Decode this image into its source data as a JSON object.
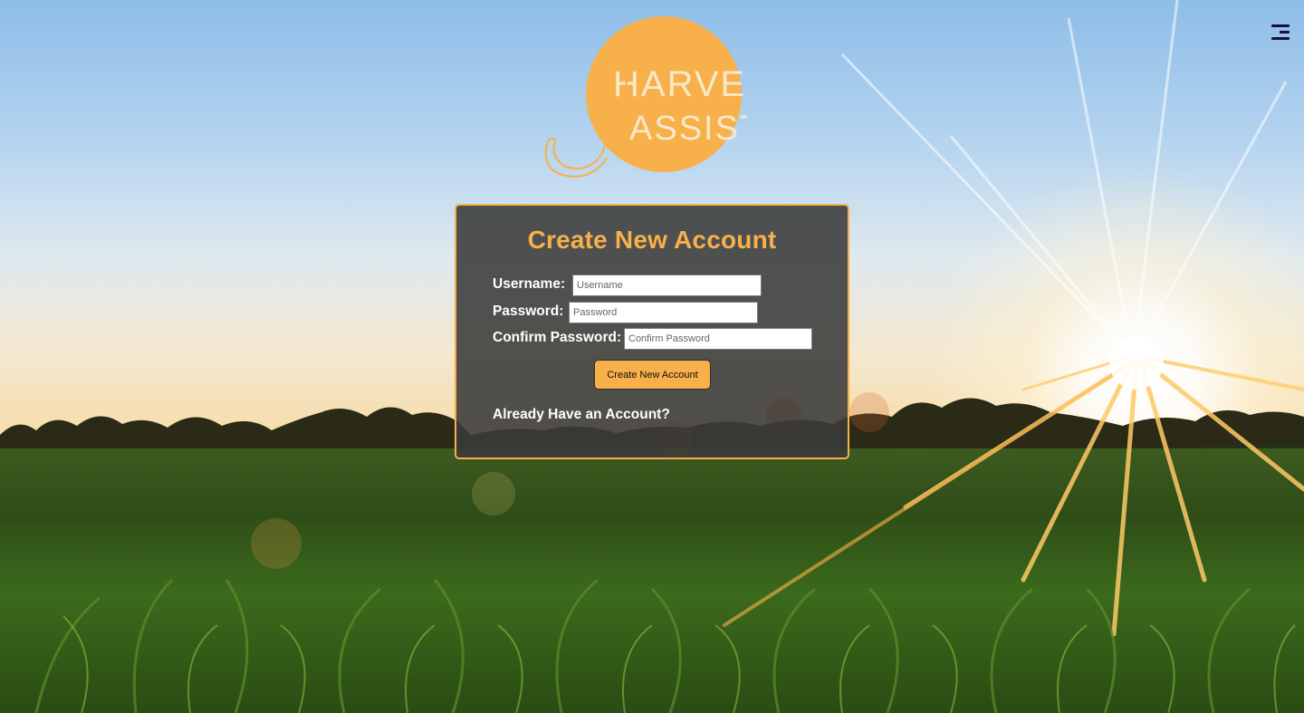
{
  "brand": {
    "logo_line1": "HARVEST",
    "logo_line2": "ASSIST",
    "logo_color": "#f7b04a"
  },
  "header": {
    "menu_icon": "menu-icon"
  },
  "form": {
    "title": "Create New Account",
    "username_label": "Username:",
    "username_placeholder": "Username",
    "username_value": "",
    "password_label": "Password:",
    "password_placeholder": "Password",
    "password_value": "",
    "confirm_label": "Confirm Password:",
    "confirm_placeholder": "Confirm Password",
    "confirm_value": "",
    "submit_label": "Create New Account",
    "login_link": "Already Have an Account?"
  },
  "theme": {
    "accent": "#f7b04a",
    "panel_bg": "#3a3a3a"
  }
}
